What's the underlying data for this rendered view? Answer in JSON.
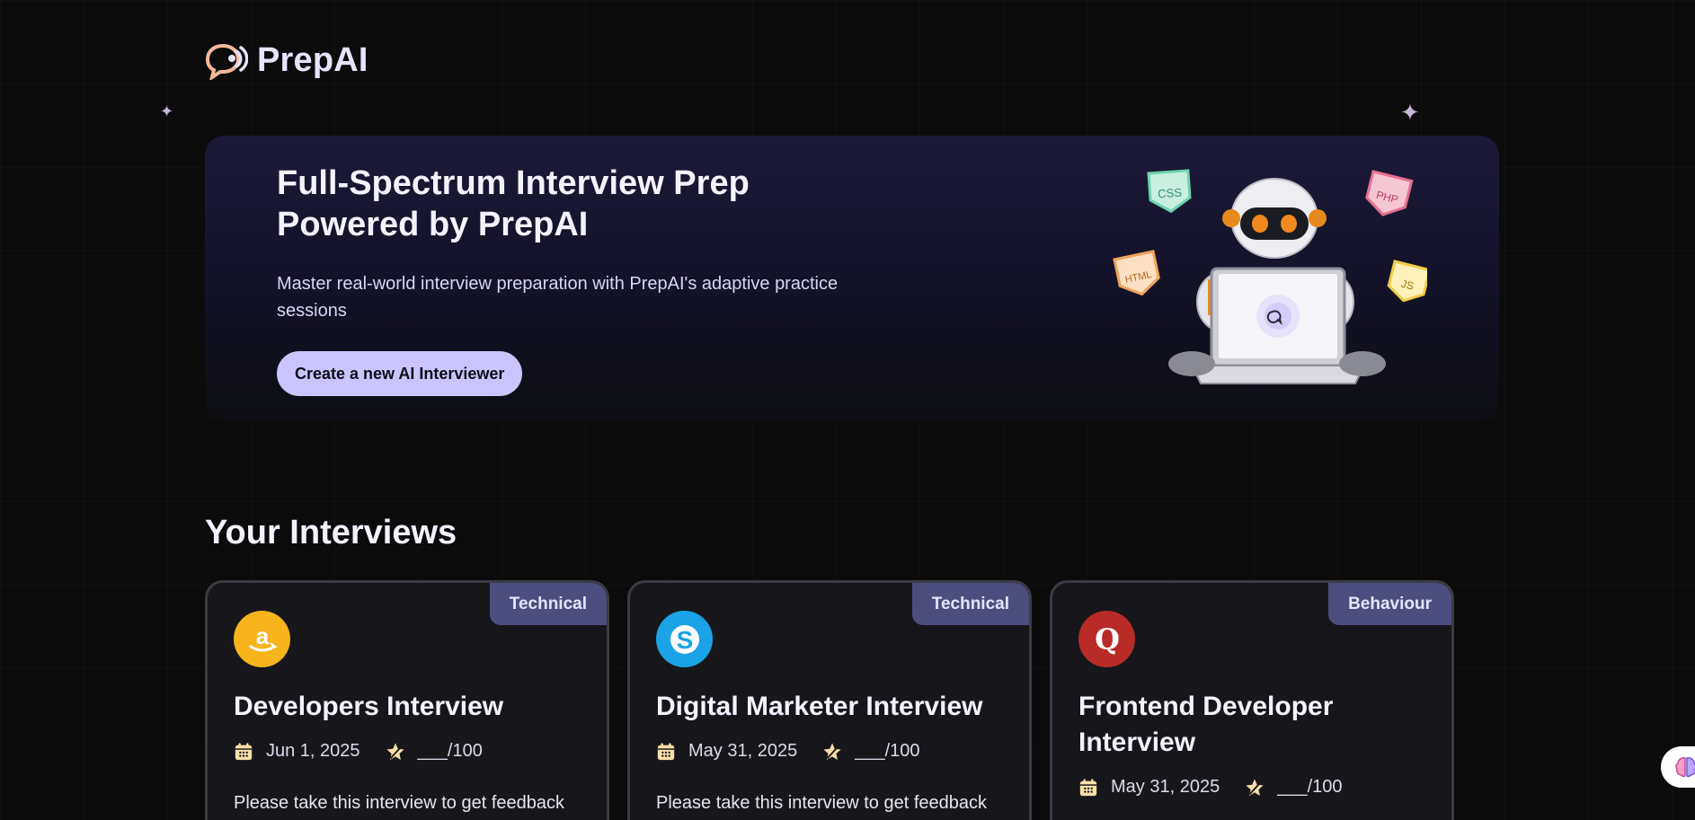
{
  "brand": {
    "name": "PrepAI",
    "accent": "#cac5fe"
  },
  "hero": {
    "title": "Full-Spectrum Interview Prep Powered by PrepAI",
    "subtitle": "Master real-world interview preparation with PrepAI's adaptive practice sessions",
    "cta_label": "Create a new AI Interviewer",
    "badges": [
      "CSS",
      "PHP",
      "HTML",
      "JS"
    ]
  },
  "interviews": {
    "heading": "Your Interviews",
    "cards": [
      {
        "company_icon": "amazon-logo-icon",
        "type": "Technical",
        "title": "Developers Interview",
        "date": "Jun 1, 2025",
        "score": "___/100",
        "description": "Please take this interview to get feedback"
      },
      {
        "company_icon": "skype-logo-icon",
        "type": "Technical",
        "title": "Digital Marketer Interview",
        "date": "May 31, 2025",
        "score": "___/100",
        "description": "Please take this interview to get feedback"
      },
      {
        "company_icon": "quora-logo-icon",
        "type": "Behaviour",
        "title": "Frontend Developer Interview",
        "date": "May 31, 2025",
        "score": "___/100",
        "description": ""
      }
    ]
  },
  "floating_action": {
    "icon": "brain-icon"
  }
}
